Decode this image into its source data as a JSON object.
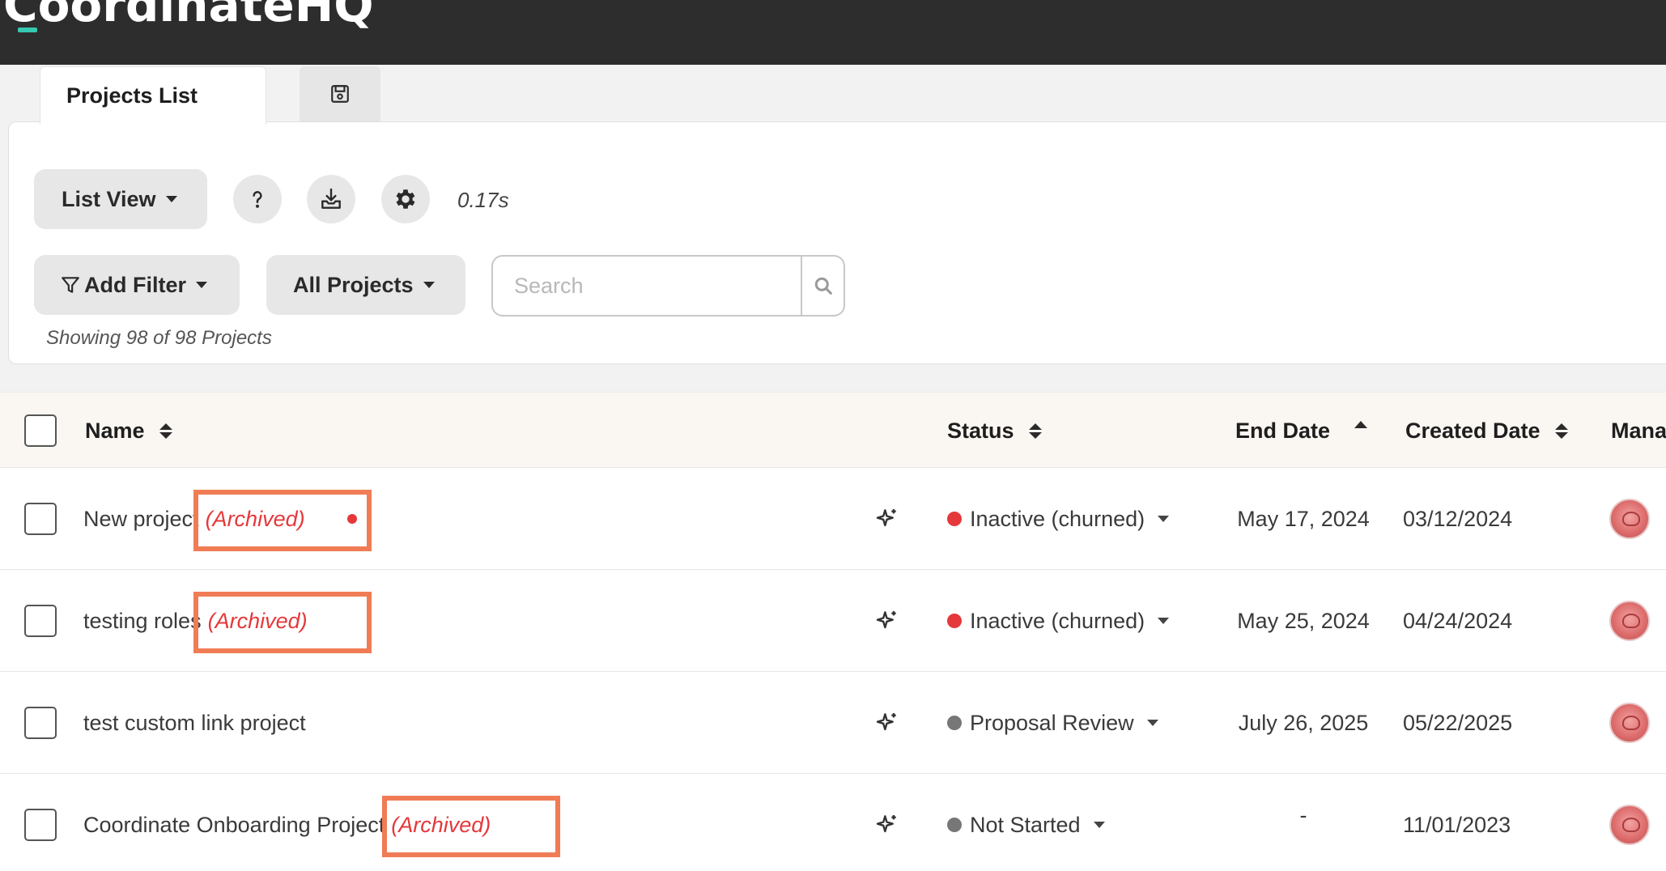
{
  "app": {
    "logo_text": "CoordinateHQ",
    "accent": "#37c9b0"
  },
  "tabs": {
    "active_label": "Projects List",
    "save_icon": "floppy-disk-icon"
  },
  "toolbar": {
    "view_label": "List View",
    "help_icon": "question-icon",
    "export_icon": "download-tray-icon",
    "settings_icon": "gear-icon",
    "timing": "0.17s",
    "filter_label": "Add Filter",
    "filter_icon": "funnel-icon",
    "scope_label": "All Projects",
    "search_placeholder": "Search",
    "search_icon": "magnifier-icon",
    "showing_text": "Showing 98 of 98 Projects"
  },
  "table": {
    "columns": [
      "Name",
      "Status",
      "End Date",
      "Created Date",
      "Mana"
    ],
    "rows": [
      {
        "name": "New project",
        "archived": "(Archived)",
        "status": "Inactive (churned)",
        "status_color": "#e5383b",
        "end_date": "May 17, 2024",
        "created_date": "03/12/2024"
      },
      {
        "name": "testing roles",
        "archived": "(Archived)",
        "status": "Inactive (churned)",
        "status_color": "#e5383b",
        "end_date": "May 25, 2024",
        "created_date": "04/24/2024"
      },
      {
        "name": "test custom link project",
        "archived": "",
        "status": "Proposal Review",
        "status_color": "#777777",
        "end_date": "July 26, 2025",
        "created_date": "05/22/2025"
      },
      {
        "name": "Coordinate Onboarding Project",
        "archived": "(Archived)",
        "status": "Not Started",
        "status_color": "#777777",
        "end_date": "-",
        "created_date": "11/01/2023"
      }
    ]
  },
  "colors": {
    "archived": "#e5383b",
    "highlight": "#f07c55",
    "header_bg": "#faf6f2"
  }
}
